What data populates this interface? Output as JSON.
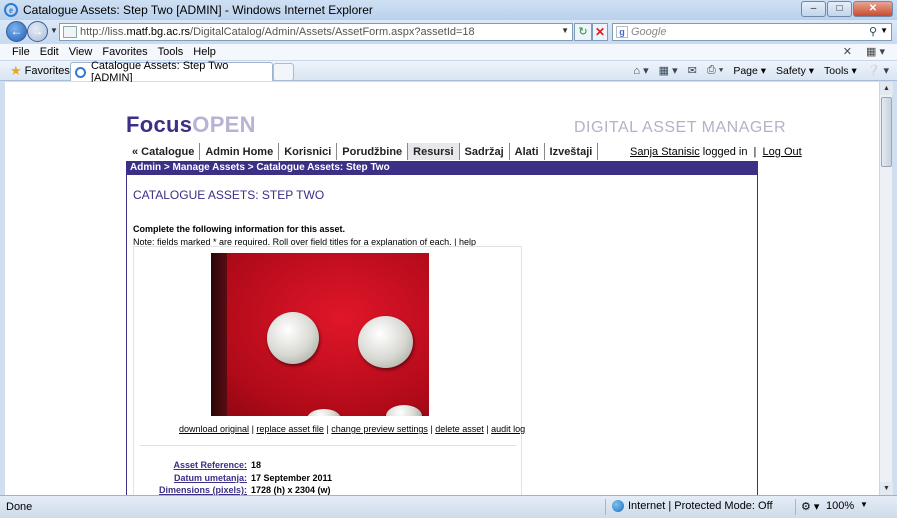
{
  "window": {
    "title": "Catalogue Assets: Step Two [ADMIN] - Windows Internet Explorer",
    "minimize": "–",
    "maximize": "□",
    "close": "✕"
  },
  "address": {
    "url_prefix": "http://liss.",
    "url_host": "matf.bg.ac.rs",
    "url_rest": "/DigitalCatalog/Admin/Assets/AssetForm.aspx?assetId=18"
  },
  "search": {
    "placeholder": "Google"
  },
  "menu": {
    "items": [
      "File",
      "Edit",
      "View",
      "Favorites",
      "Tools",
      "Help"
    ]
  },
  "favorites": {
    "label": "Favorites"
  },
  "tab": {
    "label": "Catalogue Assets: Step Two [ADMIN]"
  },
  "commandbar": {
    "page": "Page ▾",
    "safety": "Safety ▾",
    "tools": "Tools ▾"
  },
  "site": {
    "logo_focus": "Focus",
    "logo_open": "OPEN",
    "tagline": "DIGITAL ASSET MANAGER",
    "nav": [
      "« Catalogue",
      "Admin Home",
      "Korisnici",
      "Porudžbine",
      "Resursi",
      "Sadržaj",
      "Alati",
      "Izveštaji"
    ],
    "user_name": "Sanja Stanisic",
    "logged_in": "logged in",
    "logout": "Log Out",
    "breadcrumb": "Admin > Manage Assets > Catalogue Assets: Step Two",
    "page_heading": "CATALOGUE ASSETS: STEP TWO",
    "instruction": "Complete the following information for this asset.",
    "note": "Note: fields marked * are required.  Roll over field titles for a explanation of each. | ",
    "help": "help",
    "actions": {
      "download": "download original",
      "replace": "replace asset file",
      "preview": "change preview settings",
      "delete": "delete asset",
      "audit": "audit log",
      "sep": " | "
    },
    "meta": [
      {
        "key": "Asset Reference:",
        "value": "18"
      },
      {
        "key": "Datum umetanja:",
        "value": "17 September 2011"
      },
      {
        "key": "Dimensions (pixels):",
        "value": "1728 (h) x 2304 (w)"
      }
    ]
  },
  "status": {
    "done": "Done",
    "zone": "Internet | Protected Mode: Off",
    "zoom": "100%"
  },
  "colors": {
    "brand": "#3b2f86",
    "accent_light": "#b7b3d4"
  }
}
